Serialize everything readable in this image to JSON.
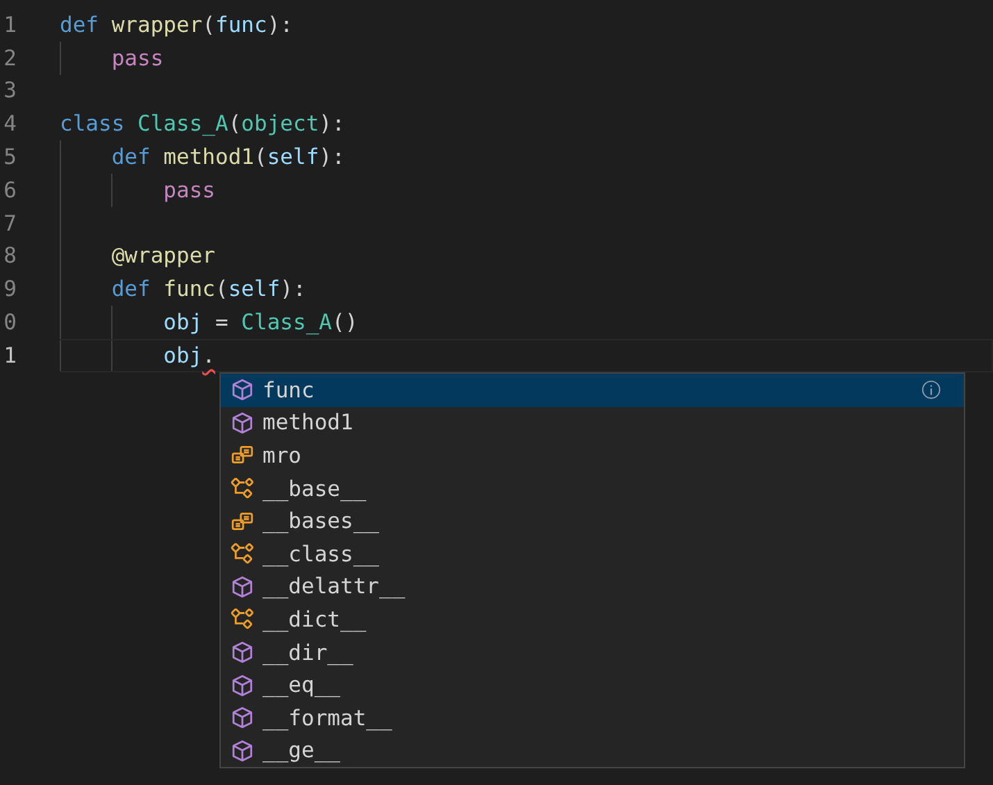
{
  "editor": {
    "lines": [
      {
        "number": "1",
        "active": false,
        "tokens": [
          {
            "kind": "keyword",
            "text": "def"
          },
          {
            "kind": "function",
            "text": " wrapper"
          },
          {
            "kind": "plain",
            "text": "("
          },
          {
            "kind": "variable",
            "text": "func"
          },
          {
            "kind": "plain",
            "text": "):"
          }
        ]
      },
      {
        "number": "2",
        "active": false,
        "tokens": [
          {
            "kind": "control",
            "text": "    pass"
          }
        ]
      },
      {
        "number": "3",
        "active": false
      },
      {
        "number": "4",
        "active": false,
        "tokens": [
          {
            "kind": "keyword",
            "text": "class"
          },
          {
            "kind": "class",
            "text": " Class_A"
          },
          {
            "kind": "plain",
            "text": "("
          },
          {
            "kind": "class",
            "text": "object"
          },
          {
            "kind": "plain",
            "text": "):"
          }
        ]
      },
      {
        "number": "5",
        "active": false,
        "tokens": [
          {
            "kind": "keyword",
            "text": "    def"
          },
          {
            "kind": "function",
            "text": " method1"
          },
          {
            "kind": "plain",
            "text": "("
          },
          {
            "kind": "variable",
            "text": "self"
          },
          {
            "kind": "plain",
            "text": "):"
          }
        ]
      },
      {
        "number": "6",
        "active": false,
        "tokens": [
          {
            "kind": "control",
            "text": "        pass"
          }
        ]
      },
      {
        "number": "7",
        "active": false
      },
      {
        "number": "8",
        "active": false,
        "tokens": [
          {
            "kind": "function",
            "text": "    @wrapper"
          }
        ]
      },
      {
        "number": "9",
        "active": false,
        "tokens": [
          {
            "kind": "keyword",
            "text": "    def"
          },
          {
            "kind": "function",
            "text": " func"
          },
          {
            "kind": "plain",
            "text": "("
          },
          {
            "kind": "variable",
            "text": "self"
          },
          {
            "kind": "plain",
            "text": "):"
          }
        ]
      },
      {
        "number": "0",
        "active": false,
        "tokens": [
          {
            "kind": "variable",
            "text": "        obj"
          },
          {
            "kind": "plain",
            "text": " = "
          },
          {
            "kind": "class",
            "text": "Class_A"
          },
          {
            "kind": "plain",
            "text": "()"
          }
        ]
      },
      {
        "number": "1",
        "active": true,
        "tokens": [
          {
            "kind": "variable",
            "text": "        obj"
          },
          {
            "kind": "error",
            "text": "."
          }
        ]
      }
    ]
  },
  "suggestions": [
    {
      "label": "func",
      "kind": "method",
      "selected": true
    },
    {
      "label": "method1",
      "kind": "method",
      "selected": false
    },
    {
      "label": "mro",
      "kind": "field",
      "selected": false
    },
    {
      "label": "__base__",
      "kind": "variable",
      "selected": false
    },
    {
      "label": "__bases__",
      "kind": "field",
      "selected": false
    },
    {
      "label": "__class__",
      "kind": "variable",
      "selected": false
    },
    {
      "label": "__delattr__",
      "kind": "method",
      "selected": false
    },
    {
      "label": "__dict__",
      "kind": "variable",
      "selected": false
    },
    {
      "label": "__dir__",
      "kind": "method",
      "selected": false
    },
    {
      "label": "__eq__",
      "kind": "method",
      "selected": false
    },
    {
      "label": "__format__",
      "kind": "method",
      "selected": false
    },
    {
      "label": "__ge__",
      "kind": "method",
      "selected": false
    }
  ]
}
